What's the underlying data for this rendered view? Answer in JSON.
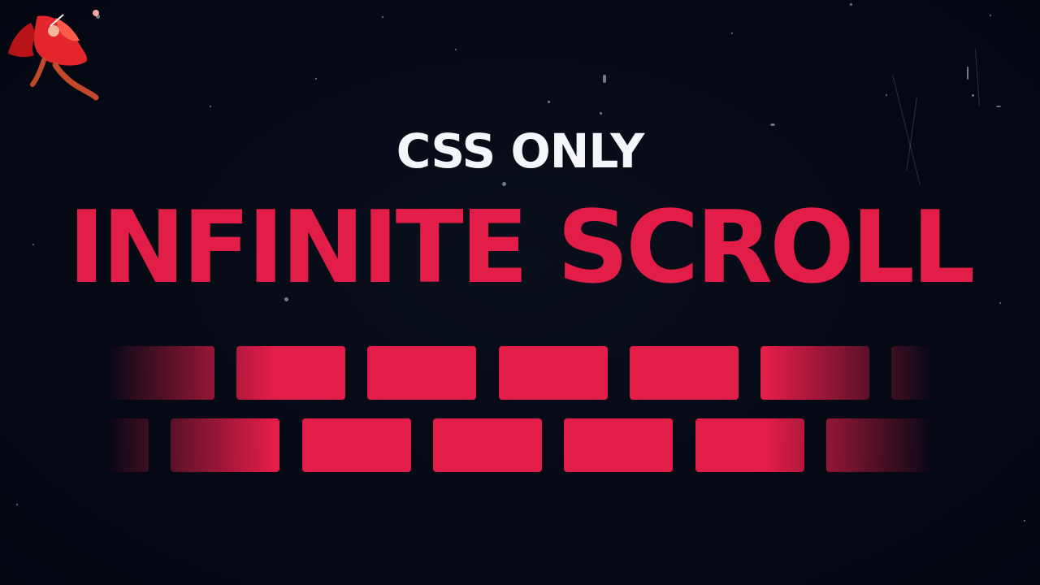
{
  "logo": {
    "name": "red-cloaked-figure-logo",
    "primary_color": "#e3262b",
    "accent_color": "#c24a2a"
  },
  "headline": {
    "subtitle": "CSS ONLY",
    "title": "INFINITE SCROLL"
  },
  "colors": {
    "background": "#050914",
    "accent": "#e11d48",
    "text": "#f4f6fb"
  },
  "scroller": {
    "rows": [
      {
        "tile_count": 7
      },
      {
        "tile_count": 7
      }
    ]
  }
}
